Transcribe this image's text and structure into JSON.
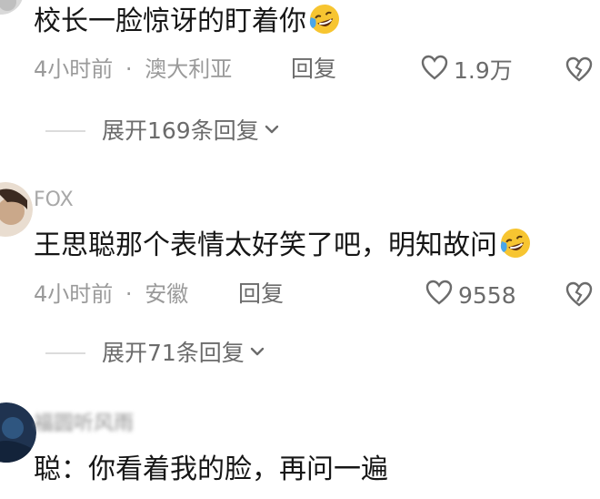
{
  "comments": [
    {
      "text": "校长一脸惊讶的盯着你",
      "emoji": "laughing-crying-emoji",
      "time": "4小时前",
      "location": "澳大利亚",
      "reply_label": "回复",
      "likes": "1.9万",
      "expand_label": "展开169条回复"
    },
    {
      "username": "FOX",
      "text": "王思聪那个表情太好笑了吧，明知故问",
      "emoji": "laughing-crying-emoji",
      "time": "4小时前",
      "location": "安徽",
      "reply_label": "回复",
      "likes": "9558",
      "expand_label": "展开71条回复"
    },
    {
      "username": "福圆听风雨",
      "text": "聪：你看着我的脸，再问一遍"
    }
  ],
  "separator": "·",
  "icons": {
    "like": "heart-outline-icon",
    "dislike": "broken-heart-icon",
    "expand": "chevron-down-icon"
  },
  "colors": {
    "text": "#161616",
    "meta": "#9a9a9a",
    "action": "#6b6b6b",
    "divider": "#dcdcdc",
    "emoji_face": "#f7c531",
    "emoji_tear": "#4aa6e8"
  }
}
